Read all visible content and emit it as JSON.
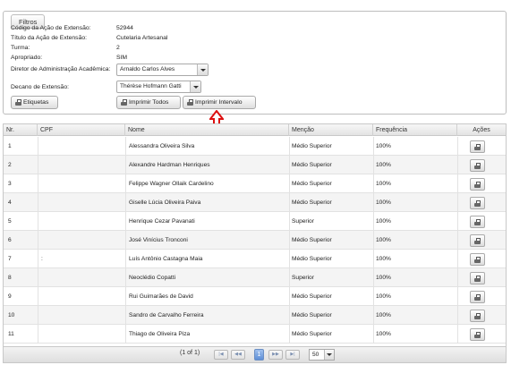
{
  "filters": {
    "legend": "Filtros",
    "fields": [
      {
        "label": "Código da Ação de Extensão:",
        "value": "52944"
      },
      {
        "label": "Título da Ação de Extensão:",
        "value": "Cutelaria Artesanal"
      },
      {
        "label": "Turma:",
        "value": "2"
      },
      {
        "label": "Apropriado:",
        "value": "SIM"
      }
    ],
    "diretor_label": "Diretor de Administração Acadêmica:",
    "diretor_value": "Arnaldo Carlos Alves",
    "decano_label": "Decano de Extensão:",
    "decano_value": "Thérèse Hofmann Gatti",
    "buttons": {
      "etiquetas": "Etiquetas",
      "imprimir_todos": "Imprimir Todos",
      "imprimir_intervalo": "Imprimir Intervalo"
    }
  },
  "annotation_color": "#dd1111",
  "table": {
    "headers": [
      "Nr.",
      "CPF",
      "Nome",
      "Menção",
      "Frequência",
      "Ações"
    ],
    "rows": [
      {
        "nr": "1",
        "cpf": "",
        "nome": "Alessandra Oliveira Silva",
        "mencao": "Médio Superior",
        "freq": "100%"
      },
      {
        "nr": "2",
        "cpf": "",
        "nome": "Alexandre Hardman Henriques",
        "mencao": "Médio Superior",
        "freq": "100%"
      },
      {
        "nr": "3",
        "cpf": "",
        "nome": "Felippe Wagner Ollaik Cardelino",
        "mencao": "Médio Superior",
        "freq": "100%"
      },
      {
        "nr": "4",
        "cpf": "",
        "nome": "Giselle Lúcia Oliveira Paiva",
        "mencao": "Médio Superior",
        "freq": "100%"
      },
      {
        "nr": "5",
        "cpf": "",
        "nome": "Henrique Cezar Pavanati",
        "mencao": "Superior",
        "freq": "100%"
      },
      {
        "nr": "6",
        "cpf": "",
        "nome": "José Vinícius Tronconi",
        "mencao": "Médio Superior",
        "freq": "100%"
      },
      {
        "nr": "7",
        "cpf": ":",
        "nome": "Luís Antônio Castagna Maia",
        "mencao": "Médio Superior",
        "freq": "100%"
      },
      {
        "nr": "8",
        "cpf": "",
        "nome": "Neoclédio Copatti",
        "mencao": "Superior",
        "freq": "100%"
      },
      {
        "nr": "9",
        "cpf": "",
        "nome": "Rui Guimarães de David",
        "mencao": "Médio Superior",
        "freq": "100%"
      },
      {
        "nr": "10",
        "cpf": "",
        "nome": "Sandro de Carvalho Ferreira",
        "mencao": "Médio Superior",
        "freq": "100%"
      },
      {
        "nr": "11",
        "cpf": "",
        "nome": "Thiago de Oliveira Piza",
        "mencao": "Médio Superior",
        "freq": "100%"
      }
    ]
  },
  "pager": {
    "info": "(1 of 1)",
    "current_page": "1",
    "rows_per_page": "50"
  }
}
